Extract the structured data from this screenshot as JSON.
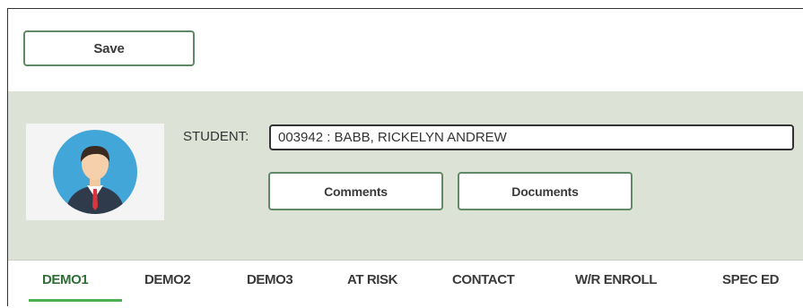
{
  "toolbar": {
    "save_label": "Save"
  },
  "student": {
    "label": "STUDENT:",
    "value": "003942 : BABB, RICKELYN ANDREW",
    "comments_label": "Comments",
    "documents_label": "Documents"
  },
  "tabs": [
    {
      "label": "DEMO1",
      "active": true
    },
    {
      "label": "DEMO2",
      "active": false
    },
    {
      "label": "DEMO3",
      "active": false
    },
    {
      "label": "AT RISK",
      "active": false
    },
    {
      "label": "CONTACT",
      "active": false
    },
    {
      "label": "W/R ENROLL",
      "active": false
    },
    {
      "label": "SPEC ED",
      "active": false
    }
  ],
  "colors": {
    "button_border": "#5f8a65",
    "panel_background": "#dde2d6",
    "active_tab_underline": "#4caf50",
    "avatar_circle": "#43a6d9"
  },
  "icons": {
    "avatar": "student-avatar-icon"
  }
}
